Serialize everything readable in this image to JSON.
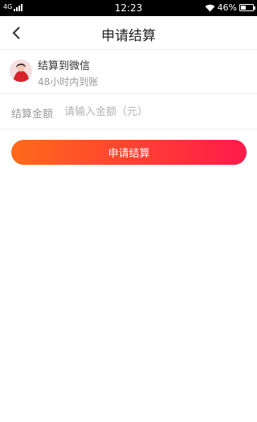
{
  "status_bar": {
    "network": "4G",
    "time": "12:23",
    "battery": "46%",
    "battery_level": 0.46,
    "icons": [
      "signal-icon",
      "wifi-icon",
      "battery-icon"
    ]
  },
  "nav": {
    "title": "申请结算",
    "back_icon": "chevron-left-icon"
  },
  "account": {
    "name": "结算到微信",
    "subtitle": "48小时内到账"
  },
  "amount": {
    "label": "结算金额",
    "placeholder": "请输入金额（元）",
    "value": ""
  },
  "submit": {
    "label": "申请结算"
  },
  "colors": {
    "gradient_start": "#ff6a1a",
    "gradient_end": "#ff1a4a",
    "divider": "#eeeeee"
  }
}
